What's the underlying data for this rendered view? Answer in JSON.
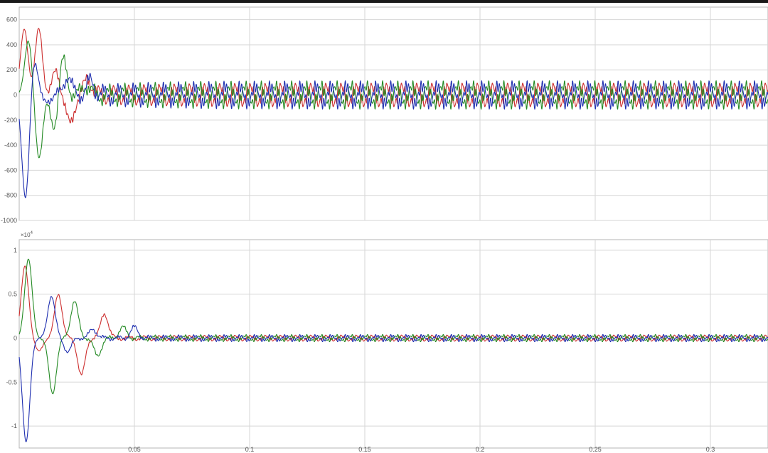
{
  "colors": {
    "background": "#ffffff",
    "grid": "#d6d6d6",
    "frame": "#b4b4b4",
    "tick_text": "#555555",
    "red": "#cc2e2e",
    "green": "#248a24",
    "blue": "#1f2fb0"
  },
  "chart_data": [
    {
      "type": "line",
      "title": "",
      "xlabel": "",
      "ylabel": "",
      "xlim": [
        0,
        0.325
      ],
      "ylim": [
        -1000,
        700
      ],
      "grid": true,
      "yticks": [
        600,
        400,
        200,
        0,
        -200,
        -400,
        -600,
        -800,
        -1000
      ],
      "ytick_labels": [
        "600",
        "400",
        "200",
        "0",
        "-200",
        "-400",
        "-600",
        "-800",
        "-1000"
      ],
      "series": [
        {
          "color": "red",
          "shape": {
            "phase": 0,
            "peaks": [
              [
                0.0022,
                520
              ],
              [
                0.0085,
                510
              ],
              [
                0.016,
                180
              ],
              [
                0.022,
                -240
              ],
              [
                0.03,
                130
              ]
            ],
            "tail_amp": 95,
            "settle": 0.025
          }
        },
        {
          "color": "green",
          "shape": {
            "phase": 2.094,
            "peaks": [
              [
                0.004,
                440
              ],
              [
                0.0085,
                -490
              ],
              [
                0.015,
                -260
              ],
              [
                0.019,
                280
              ],
              [
                0.029,
                80
              ]
            ],
            "tail_amp": 95,
            "settle": 0.025
          }
        },
        {
          "color": "blue",
          "shape": {
            "phase": -2.094,
            "peaks": [
              [
                0.0028,
                -840
              ],
              [
                0.0065,
                310
              ],
              [
                0.011,
                -70
              ],
              [
                0.021,
                150
              ],
              [
                0.031,
                110
              ]
            ],
            "tail_amp": 95,
            "settle": 0.025
          }
        }
      ]
    },
    {
      "type": "line",
      "title": "",
      "xlabel": "",
      "ylabel": "",
      "xlim": [
        0,
        0.325
      ],
      "ylim": [
        -1.25,
        1.12
      ],
      "y_exponent_label": "×10",
      "y_exponent_power": "4",
      "grid": true,
      "yticks": [
        1,
        0.5,
        0,
        -0.5,
        -1
      ],
      "ytick_labels": [
        "1",
        "0.5",
        "0",
        "-0.5",
        "-1"
      ],
      "xticks": [
        0.05,
        0.1,
        0.15,
        0.2,
        0.25,
        0.3
      ],
      "xtick_labels": [
        "0.05",
        "0.1",
        "0.15",
        "0.2",
        "0.25",
        "0.3"
      ],
      "series": [
        {
          "color": "red",
          "shape": {
            "phase": 0,
            "peaks": [
              [
                0.0025,
                0.82
              ],
              [
                0.0085,
                -0.15
              ],
              [
                0.017,
                0.5
              ],
              [
                0.027,
                -0.42
              ],
              [
                0.037,
                0.28
              ]
            ],
            "tail_amp": 0.035,
            "settle": 0.03
          }
        },
        {
          "color": "green",
          "shape": {
            "phase": 2.094,
            "peaks": [
              [
                0.004,
                0.9
              ],
              [
                0.0145,
                -0.63
              ],
              [
                0.024,
                0.42
              ],
              [
                0.034,
                -0.2
              ],
              [
                0.045,
                0.12
              ]
            ],
            "tail_amp": 0.035,
            "settle": 0.03
          }
        },
        {
          "color": "blue",
          "shape": {
            "phase": -2.094,
            "peaks": [
              [
                0.003,
                -1.18
              ],
              [
                0.014,
                0.48
              ],
              [
                0.021,
                -0.15
              ],
              [
                0.032,
                0.1
              ],
              [
                0.05,
                0.12
              ]
            ],
            "tail_amp": 0.035,
            "settle": 0.03
          }
        }
      ]
    }
  ]
}
